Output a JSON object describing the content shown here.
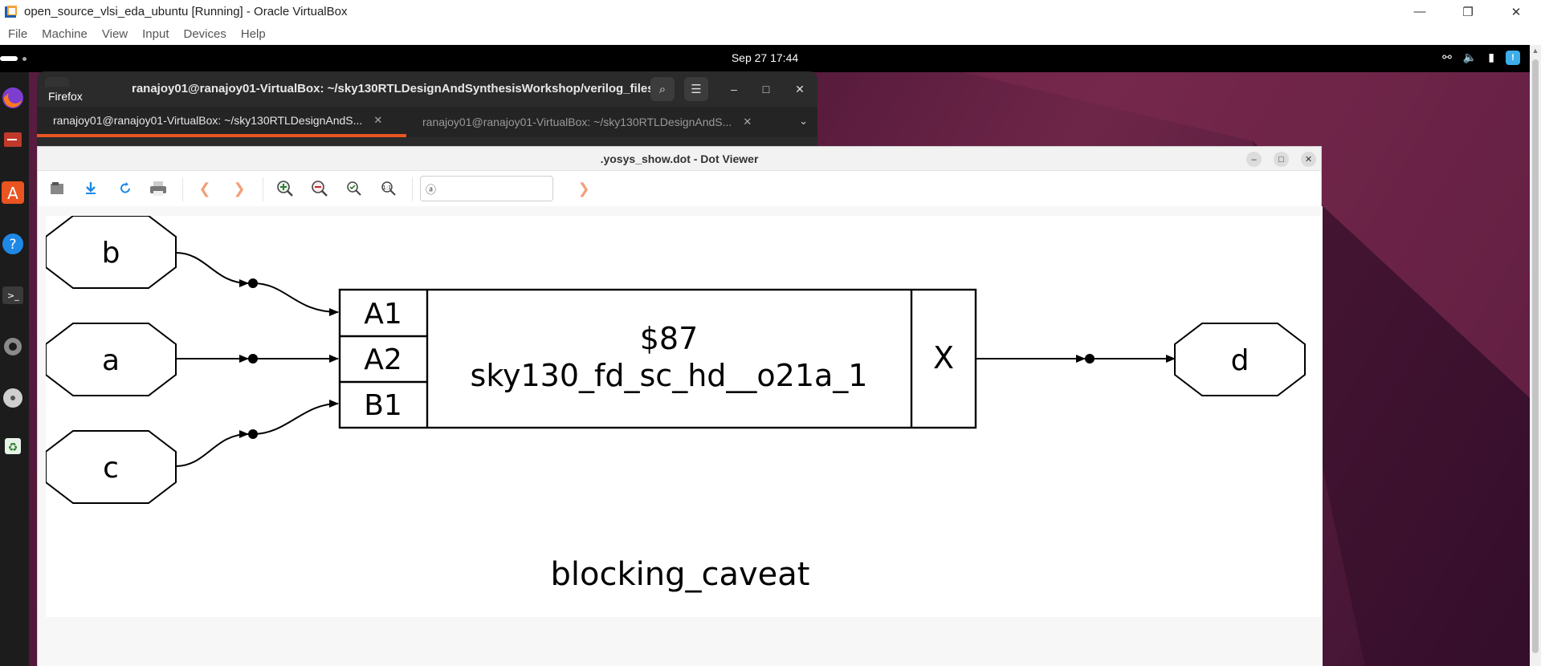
{
  "vbox": {
    "title": "open_source_vlsi_eda_ubuntu [Running] - Oracle VirtualBox",
    "menu": [
      "File",
      "Machine",
      "View",
      "Input",
      "Devices",
      "Help"
    ],
    "window_controls": {
      "minimize": "—",
      "restore": "❐",
      "close": "✕"
    }
  },
  "guest": {
    "topbar": {
      "clock": "Sep 27  17:44"
    },
    "tooltip": "Firefox"
  },
  "terminal": {
    "title": "ranajoy01@ranajoy01-VirtualBox: ~/sky130RTLDesignAndSynthesisWorkshop/verilog_files",
    "tabs": [
      {
        "label": "ranajoy01@ranajoy01-VirtualBox: ~/sky130RTLDesignAndS...",
        "active": true
      },
      {
        "label": "ranajoy01@ranajoy01-VirtualBox: ~/sky130RTLDesignAndS...",
        "active": false
      }
    ],
    "tab_close": "✕"
  },
  "dotviewer": {
    "title": ".yosys_show.dot - Dot Viewer",
    "search_placeholder": "",
    "graph": {
      "inputs": [
        "b",
        "a",
        "c"
      ],
      "output": "d",
      "cell_id": "$87",
      "cell_type": "sky130_fd_sc_hd__o21a_1",
      "cell_inputs": [
        "A1",
        "A2",
        "B1"
      ],
      "cell_output": "X",
      "module_name": "blocking_caveat"
    }
  },
  "colors": {
    "accent": "#e95420",
    "terminal_bg": "#2b2b2b",
    "topbar": "#000000"
  }
}
